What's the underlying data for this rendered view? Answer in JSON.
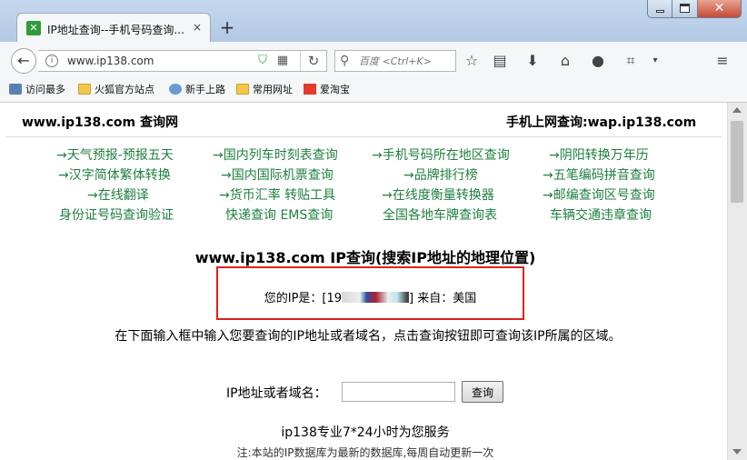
{
  "window": {
    "tab_title": "IP地址查询--手机号码查询...",
    "tab_close": "×",
    "new_tab": "+",
    "close_glyph": "✕"
  },
  "toolbar": {
    "url": "www.ip138.com",
    "search_placeholder": "百度 <Ctrl+K>",
    "icons": [
      "back-arrow-icon",
      "info-icon",
      "shield-icon",
      "qr-code-icon",
      "reload-icon",
      "search-icon",
      "bookmark-star-icon",
      "reading-list-icon",
      "download-icon",
      "home-icon",
      "chat-icon",
      "screenshot-icon",
      "dropdown-icon",
      "hamburger-menu-icon"
    ]
  },
  "bookmarks": [
    {
      "label": "访问最多",
      "icon": "settings-icon"
    },
    {
      "label": "火狐官方站点",
      "icon": "folder-icon"
    },
    {
      "label": "新手上路",
      "icon": "globe-icon"
    },
    {
      "label": "常用网址",
      "icon": "folder-icon"
    },
    {
      "label": "爱淘宝",
      "icon": "taobao-icon"
    }
  ],
  "page": {
    "site_title": "www.ip138.com 查询网",
    "mobile_link": "手机上网查询:wap.ip138.com",
    "link_rows": [
      [
        "→天气预报-预报五天",
        "→国内列车时刻表查询",
        "→手机号码所在地区查询",
        "→阴阳转换万年历"
      ],
      [
        "→汉字简体繁体转换",
        "→国内国际机票查询",
        "→品牌排行榜",
        "→五笔编码拼音查询"
      ],
      [
        "→在线翻译",
        "→货币汇率 转贴工具",
        "→在线度衡量转换器",
        "→邮编查询区号查询"
      ],
      [
        "身份证号码查询验证",
        "快递查询 EMS查询",
        "全国各地车牌查询表",
        "车辆交通违章查询"
      ]
    ],
    "main_title": "www.ip138.com IP查询(搜索IP地址的地理位置)",
    "ip_prefix": "您的IP是：[19",
    "ip_suffix": "] 来自：美国",
    "instruction": "在下面输入框中输入您要查询的IP地址或者域名，点击查询按钮即可查询该IP所属的区域。",
    "form_label": "IP地址或者域名：",
    "query_button": "查询",
    "service_line": "ip138专业7*24小时为您服务",
    "note_line": "注:本站的IP数据库为最新的数据库,每周自动更新一次"
  },
  "colors": {
    "link_green": "#1e7f3f",
    "highlight_red": "#e02020",
    "titlebar_blue": "#c4d7ed"
  }
}
